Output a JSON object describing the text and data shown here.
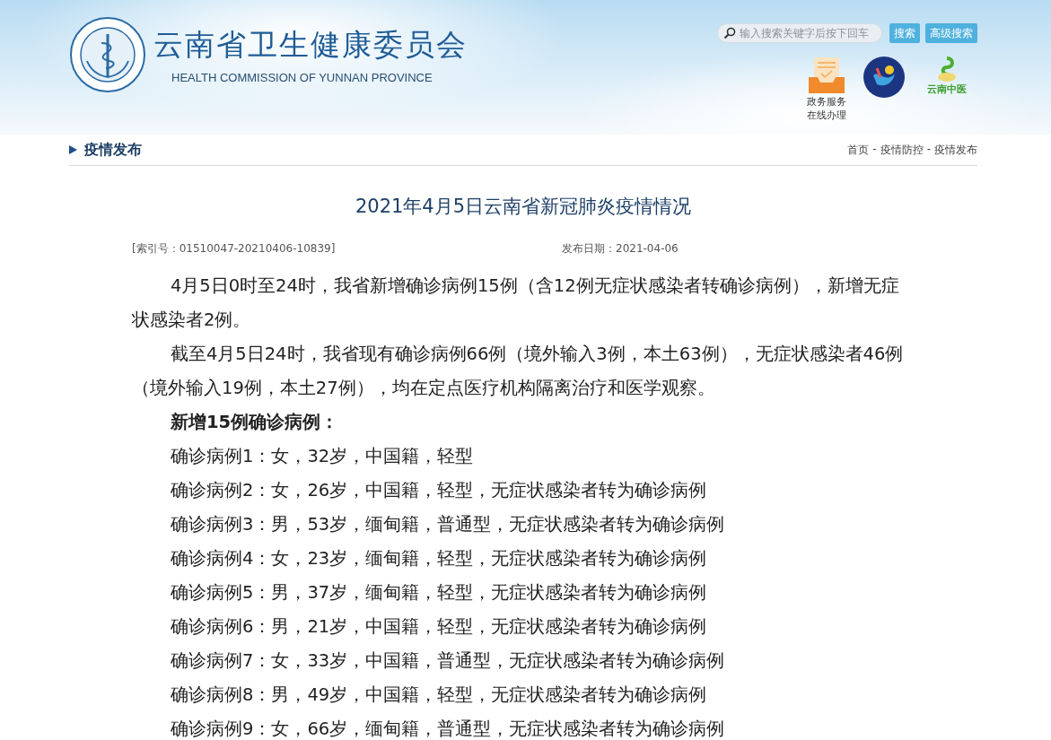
{
  "header": {
    "title": "云南省卫生健康委员会",
    "subtitle": "HEALTH COMMISSION OF YUNNAN PROVINCE",
    "search": {
      "placeholder": "输入搜索关键字后按下回车"
    },
    "buttons": [
      "搜索",
      "高级搜索"
    ],
    "service_label": [
      "政务服务",
      "在线办理"
    ],
    "tcm_logo_text": "云南中医"
  },
  "section": {
    "title": "疫情发布",
    "breadcrumb": [
      "首页",
      "疫情防控",
      "疫情发布"
    ],
    "separator": "-"
  },
  "article": {
    "title": "2021年4月5日云南省新冠肺炎疫情情况",
    "index_no": "[索引号：01510047-20210406-10839]",
    "date": "发布日期：2021-04-06",
    "paragraphs": [
      "4月5日0时至24时，我省新增确诊病例15例（含12例无症状感染者转确诊病例），新增无症状感染者2例。",
      "截至4月5日24时，我省现有确诊病例66例（境外输入3例，本土63例），无症状感染者46例（境外输入19例，本土27例），均在定点医疗机构隔离治疗和医学观察。"
    ],
    "cases_heading": "新增15例确诊病例：",
    "cases": [
      "确诊病例1：女，32岁，中国籍，轻型",
      "确诊病例2：女，26岁，中国籍，轻型，无症状感染者转为确诊病例",
      "确诊病例3：男，53岁，缅甸籍，普通型，无症状感染者转为确诊病例",
      "确诊病例4：女，23岁，缅甸籍，轻型，无症状感染者转为确诊病例",
      "确诊病例5：男，37岁，缅甸籍，轻型，无症状感染者转为确诊病例",
      "确诊病例6：男，21岁，中国籍，轻型，无症状感染者转为确诊病例",
      "确诊病例7：女，33岁，中国籍，普通型，无症状感染者转为确诊病例",
      "确诊病例8：男，49岁，中国籍，轻型，无症状感染者转为确诊病例",
      "确诊病例9：女，66岁，缅甸籍，普通型，无症状感染者转为确诊病例"
    ]
  }
}
